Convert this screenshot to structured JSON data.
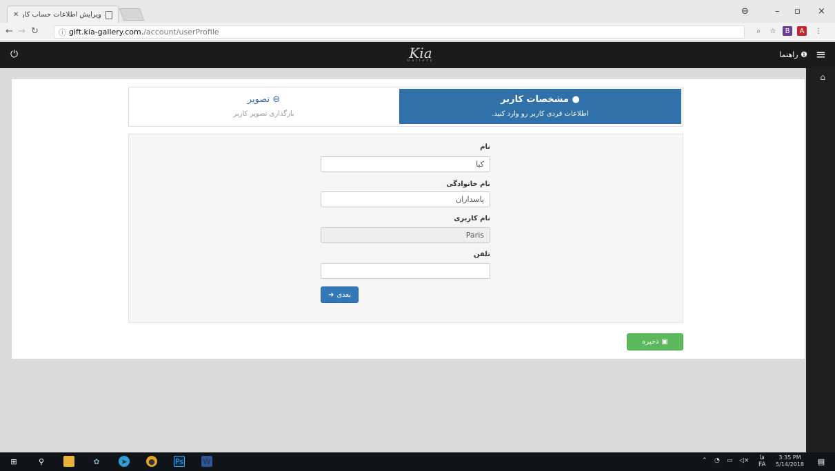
{
  "browser": {
    "tab_title": "ویرایش اطلاعات حساب کار",
    "url_host": "gift.kia-gallery.com.",
    "url_path": "/account/userProfile",
    "controls": {
      "minimize": "–",
      "maximize": "▫",
      "close": "×"
    }
  },
  "app": {
    "logo_text": "Kia",
    "logo_sub": "Gallery",
    "help_label": "راهنما"
  },
  "steps": [
    {
      "title": "مشخصات کاربر",
      "subtitle": "اطلاعات فردی کاربر رو وارد کنید.",
      "active": true
    },
    {
      "title": "تصویر",
      "subtitle": "بارگذاری تصویر کاربر",
      "active": false
    }
  ],
  "form": {
    "first_name": {
      "label": "نام",
      "value": "کیا"
    },
    "last_name": {
      "label": "نام خانوادگی",
      "value": "پاسداران"
    },
    "username": {
      "label": "نام کاربری",
      "value": "Paris"
    },
    "phone": {
      "label": "تلفن",
      "value": ""
    },
    "next_label": "بعدی",
    "save_label": "ذخیره"
  },
  "taskbar": {
    "lang_1": "فا",
    "lang_2": "FA",
    "time": "3:35 PM",
    "date": "5/14/2018"
  },
  "colors": {
    "active_step": "#3071a9",
    "save_button": "#5cb85c",
    "next_button": "#3479b7"
  }
}
